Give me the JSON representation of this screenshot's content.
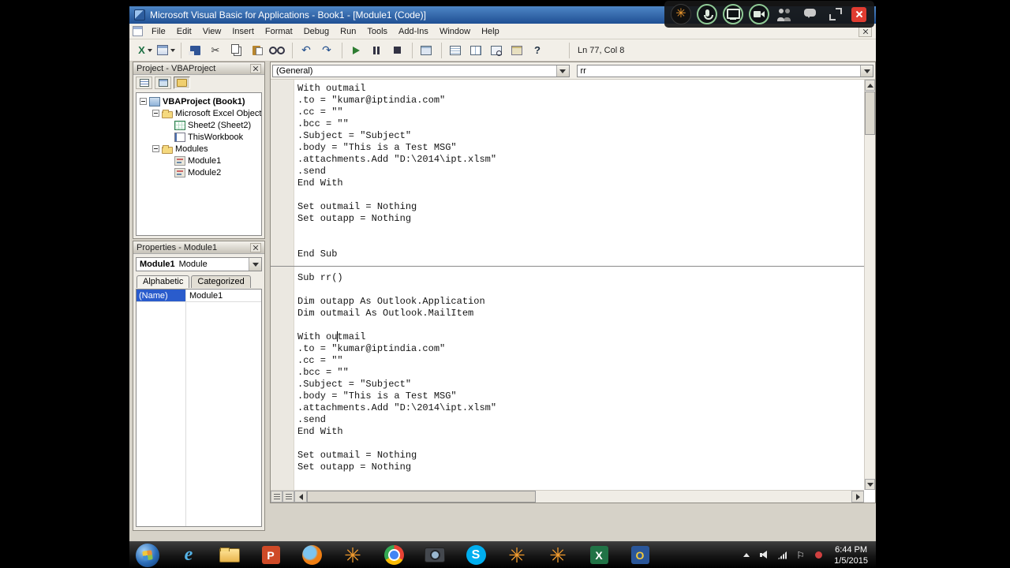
{
  "window": {
    "title": "Microsoft Visual Basic for Applications - Book1 - [Module1 (Code)]"
  },
  "menu": {
    "items": [
      "File",
      "Edit",
      "View",
      "Insert",
      "Format",
      "Debug",
      "Run",
      "Tools",
      "Add-Ins",
      "Window",
      "Help"
    ]
  },
  "toolbar": {
    "position_label": "Ln 77, Col 8",
    "buttons": [
      {
        "name": "view-microsoft-excel-icon",
        "icon": "excel-view"
      },
      {
        "name": "insert-userform-icon",
        "icon": "insert-userform"
      },
      {
        "name": "save-icon",
        "icon": "save"
      },
      {
        "name": "cut-icon",
        "icon": "cut"
      },
      {
        "name": "copy-icon",
        "icon": "copy"
      },
      {
        "name": "paste-icon",
        "icon": "paste"
      },
      {
        "name": "find-icon",
        "icon": "find"
      },
      {
        "name": "undo-icon",
        "icon": "undo"
      },
      {
        "name": "redo-icon",
        "icon": "redo"
      },
      {
        "name": "run-icon",
        "icon": "run"
      },
      {
        "name": "break-icon",
        "icon": "break"
      },
      {
        "name": "reset-icon",
        "icon": "reset"
      },
      {
        "name": "design-mode-icon",
        "icon": "design"
      },
      {
        "name": "project-explorer-icon",
        "icon": "projexp"
      },
      {
        "name": "properties-window-icon",
        "icon": "propwin"
      },
      {
        "name": "object-browser-icon",
        "icon": "objbrowse"
      },
      {
        "name": "toolbox-icon",
        "icon": "toolbox"
      },
      {
        "name": "help-icon",
        "icon": "help"
      }
    ]
  },
  "project": {
    "title": "Project - VBAProject",
    "toolbar": [
      {
        "name": "view-code-button",
        "icon": "pt-code",
        "state": "normal"
      },
      {
        "name": "view-object-button",
        "icon": "pt-object",
        "state": "normal"
      },
      {
        "name": "toggle-folders-button",
        "icon": "pt-folders",
        "state": "pressed"
      }
    ],
    "tree": [
      {
        "levelClass": "lv0",
        "expanderClass": "minus",
        "icon": "ic-project",
        "iconName": "vbaproject-icon",
        "label": "VBAProject (Book1)"
      },
      {
        "levelClass": "lv1",
        "expanderClass": "minus",
        "icon": "ic-folder",
        "iconName": "folder-icon",
        "label": "Microsoft Excel Objects"
      },
      {
        "levelClass": "lv2",
        "expanderClass": "leaf",
        "icon": "ic-sheet",
        "iconName": "worksheet-icon",
        "label": "Sheet2 (Sheet2)"
      },
      {
        "levelClass": "lv2",
        "expanderClass": "leaf",
        "icon": "ic-book",
        "iconName": "workbook-icon",
        "label": "ThisWorkbook"
      },
      {
        "levelClass": "lv1",
        "expanderClass": "minus",
        "icon": "ic-folder",
        "iconName": "folder-icon",
        "label": "Modules"
      },
      {
        "levelClass": "lv2",
        "expanderClass": "leaf",
        "icon": "ic-module",
        "iconName": "module-icon",
        "label": "Module1"
      },
      {
        "levelClass": "lv2",
        "expanderClass": "leaf",
        "icon": "ic-module",
        "iconName": "module-icon",
        "label": "Module2"
      }
    ]
  },
  "properties": {
    "title": "Properties - Module1",
    "selector": {
      "name": "Module1",
      "type": "Module"
    },
    "tabs": [
      {
        "label": "Alphabetic",
        "state": "active"
      },
      {
        "label": "Categorized",
        "state": "inactive"
      }
    ],
    "rows": [
      {
        "name": "(Name)",
        "value": "Module1",
        "stateClass": "selected"
      }
    ]
  },
  "code": {
    "object_dropdown": "(General)",
    "procedure_dropdown": "rr",
    "block1": [
      "With outmail",
      ".to = \"kumar@iptindia.com\"",
      ".cc = \"\"",
      ".bcc = \"\"",
      ".Subject = \"Subject\"",
      ".body = \"This is a Test MSG\"",
      ".attachments.Add \"D:\\2014\\ipt.xlsm\"",
      ".send",
      "End With",
      "",
      "Set outmail = Nothing",
      "Set outapp = Nothing",
      "",
      "",
      "End Sub"
    ],
    "block2": [
      "Sub rr()",
      "",
      "Dim outapp As Outlook.Application",
      "Dim outmail As Outlook.MailItem",
      "",
      "With outmail",
      ".to = \"kumar@iptindia.com\"",
      ".cc = \"\"",
      ".bcc = \"\"",
      ".Subject = \"Subject\"",
      ".body = \"This is a Test MSG\"",
      ".attachments.Add \"D:\\2014\\ipt.xlsm\"",
      ".send",
      "End With",
      "",
      "Set outmail = Nothing",
      "Set outapp = Nothing",
      "",
      "",
      "End Sub"
    ]
  },
  "taskbar": {
    "items": [
      {
        "name": "start-button",
        "icon": "start"
      },
      {
        "name": "internet-explorer-icon",
        "icon": "ie"
      },
      {
        "name": "windows-explorer-icon",
        "icon": "folder"
      },
      {
        "name": "powerpoint-icon",
        "icon": "ppt"
      },
      {
        "name": "firefox-icon",
        "icon": "firefox"
      },
      {
        "name": "flower-app-icon",
        "icon": "flower"
      },
      {
        "name": "chrome-icon",
        "icon": "chrome"
      },
      {
        "name": "camera-app-icon",
        "icon": "camera"
      },
      {
        "name": "skype-icon",
        "icon": "skype"
      },
      {
        "name": "flower-app-icon",
        "icon": "flower"
      },
      {
        "name": "flower-app-icon",
        "icon": "flower"
      },
      {
        "name": "excel-icon",
        "icon": "excel"
      },
      {
        "name": "outlook-icon",
        "icon": "outlook"
      }
    ],
    "tray": [
      {
        "name": "tray-expand-icon",
        "icon": "tray-up"
      },
      {
        "name": "volume-icon",
        "icon": "tray-vol"
      },
      {
        "name": "network-icon",
        "icon": "tray-net"
      },
      {
        "name": "action-center-icon",
        "icon": "tray-flag"
      },
      {
        "name": "notification-icon",
        "icon": "tray-red"
      }
    ],
    "clock": {
      "time": "6:44 PM",
      "date": "1/5/2015"
    }
  },
  "overlay": {
    "items": [
      {
        "name": "recorder-app-icon",
        "icon": "ov-flower"
      },
      {
        "name": "microphone-icon",
        "icon": "ov-mic"
      },
      {
        "name": "screen-share-icon",
        "icon": "ov-screen"
      },
      {
        "name": "webcam-icon",
        "icon": "ov-cam"
      },
      {
        "name": "participants-icon",
        "icon": "ov-people"
      },
      {
        "name": "chat-icon",
        "icon": "ov-chat"
      },
      {
        "name": "fullscreen-icon",
        "icon": "ov-expand"
      },
      {
        "name": "overlay-close-icon",
        "icon": "ov-close"
      }
    ]
  },
  "colors": {
    "titlebar_blue": "#2f5f9e",
    "selection_blue": "#2a5ccc",
    "run_green": "#2e7d32",
    "taskbar_black": "#111111"
  }
}
